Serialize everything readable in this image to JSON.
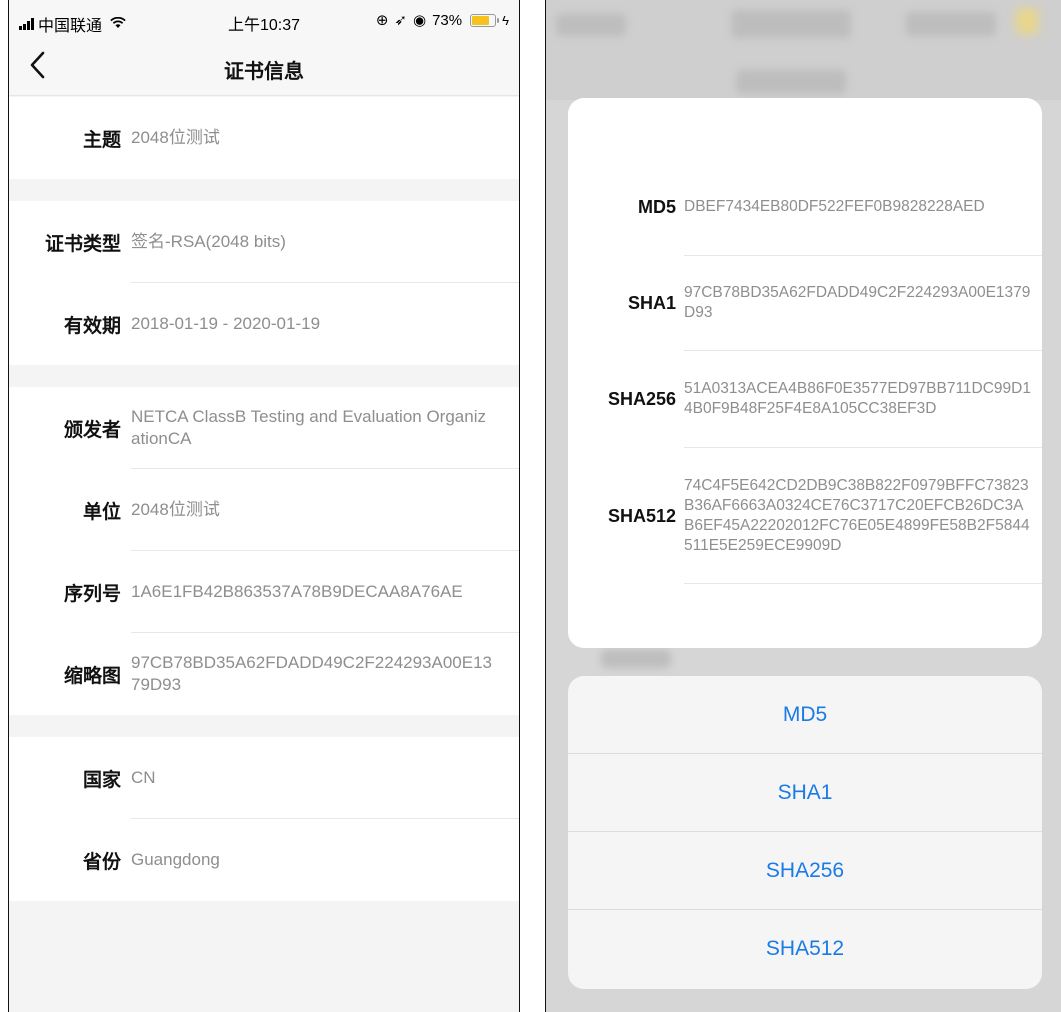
{
  "status_bar": {
    "carrier": "中国联通",
    "time": "上午10:37",
    "battery_percent": "73%"
  },
  "nav": {
    "title": "证书信息"
  },
  "cert_groups": [
    [
      {
        "label": "主题",
        "value": "2048位测试"
      }
    ],
    [
      {
        "label": "证书类型",
        "value": "签名-RSA(2048 bits)"
      },
      {
        "label": "有效期",
        "value": "2018-01-19 - 2020-01-19"
      }
    ],
    [
      {
        "label": "颁发者",
        "value": "NETCA ClassB Testing and Evaluation OrganizationCA"
      },
      {
        "label": "单位",
        "value": "2048位测试"
      },
      {
        "label": "序列号",
        "value": "1A6E1FB42B863537A78B9DECAA8A76AE"
      },
      {
        "label": "缩略图",
        "value": "97CB78BD35A62FDADD49C2F224293A00E1379D93"
      }
    ],
    [
      {
        "label": "国家",
        "value": "CN"
      },
      {
        "label": "省份",
        "value": "Guangdong"
      }
    ]
  ],
  "hashes": [
    {
      "label": "MD5",
      "value": "DBEF7434EB80DF522FEF0B9828228AED"
    },
    {
      "label": "SHA1",
      "value": "97CB78BD35A62FDADD49C2F224293A00E1379D93"
    },
    {
      "label": "SHA256",
      "value": "51A0313ACEA4B86F0E3577ED97BB711DC99D14B0F9B48F25F4E8A105CC38EF3D"
    },
    {
      "label": "SHA512",
      "value": "74C4F5E642CD2DB9C38B822F0979BFFC73823B36AF6663A0324CE76C3717C20EFCB26DC3AB6EF45A22202012FC76E05E4899FE58B2F5844511E5E259ECE9909D"
    }
  ],
  "actions": [
    "MD5",
    "SHA1",
    "SHA256",
    "SHA512"
  ],
  "colors": {
    "action_text": "#1a7be6",
    "value_text": "#8e8e8e",
    "battery": "#f6c21c"
  }
}
